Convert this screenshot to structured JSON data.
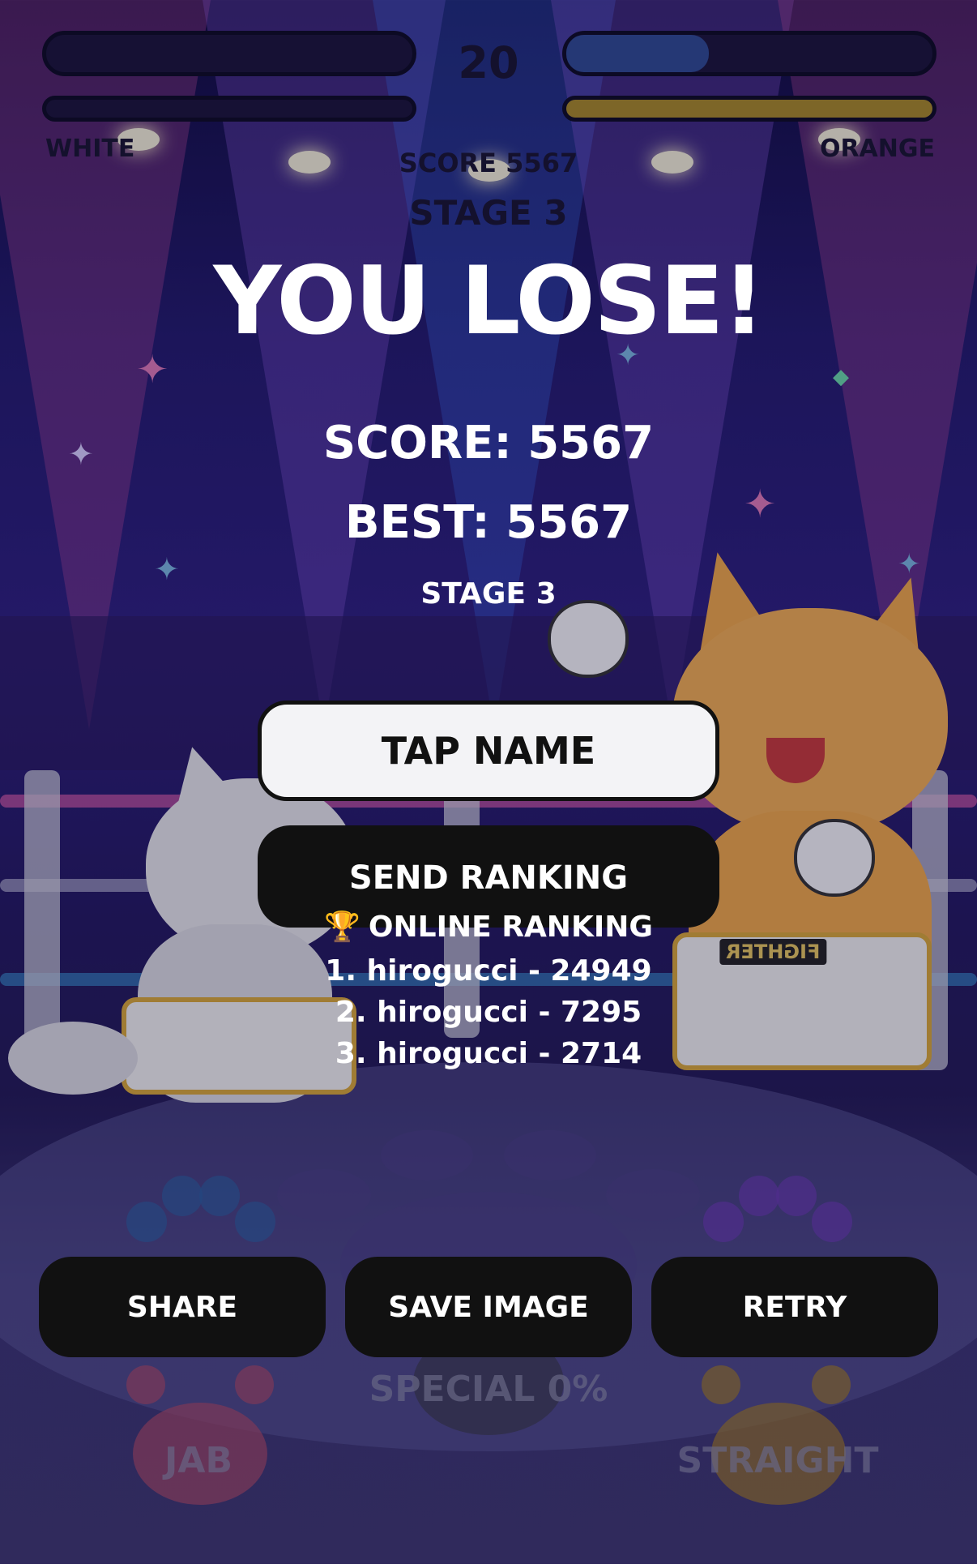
{
  "hud": {
    "timer": "20",
    "player_left": {
      "name": "WHITE",
      "hp_fraction": 0.0,
      "special_fraction": 0.0
    },
    "player_right": {
      "name": "ORANGE",
      "hp_fraction": 0.39,
      "special_fraction": 1.0
    },
    "score_text": "SCORE 5567",
    "stage_text": "STAGE 3",
    "colors": {
      "right_hp": "#2e4a92",
      "right_special": "#a88a28",
      "left_accent": "#e04040"
    }
  },
  "result": {
    "title": "YOU LOSE!",
    "score_line": "SCORE: 5567",
    "best_line": "BEST: 5567",
    "stage_line": "STAGE 3"
  },
  "name_entry": {
    "placeholder": "TAP NAME",
    "value": ""
  },
  "send_button": {
    "label": "SEND RANKING"
  },
  "ranking": {
    "header_icon": "trophy-icon",
    "header_emoji": "🏆",
    "header": "ONLINE RANKING",
    "entries": [
      "1. hirogucci - 24949",
      "2. hirogucci - 7295",
      "3. hirogucci - 2714"
    ]
  },
  "actions": {
    "share": "SHARE",
    "save_image": "SAVE IMAGE",
    "retry": "RETRY"
  },
  "controls": {
    "jab": "JAB",
    "special": "SPECIAL 0%",
    "straight": "STRAIGHT"
  },
  "scene": {
    "left_belt_text": "",
    "right_belt_text": "FIGHTER"
  }
}
